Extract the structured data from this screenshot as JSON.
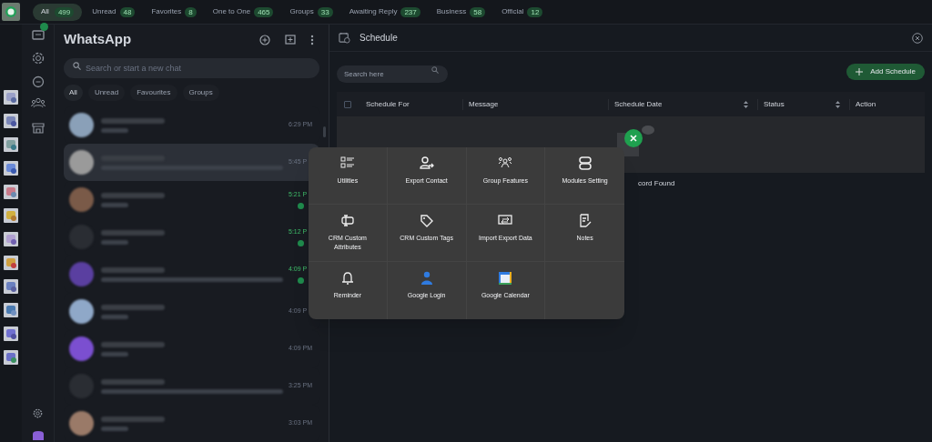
{
  "filters": [
    {
      "label": "All",
      "count": "499",
      "selected": true
    },
    {
      "label": "Unread",
      "count": "48",
      "selected": false
    },
    {
      "label": "Favorites",
      "count": "8",
      "selected": false
    },
    {
      "label": "One to One",
      "count": "465",
      "selected": false
    },
    {
      "label": "Groups",
      "count": "33",
      "selected": false
    },
    {
      "label": "Awaiting Reply",
      "count": "237",
      "selected": false
    },
    {
      "label": "Business",
      "count": "58",
      "selected": false
    },
    {
      "label": "Official",
      "count": "12",
      "selected": false
    }
  ],
  "chat_panel": {
    "title": "WhatsApp",
    "search": {
      "placeholder": "Search or start a new chat"
    },
    "chips": [
      {
        "label": "All",
        "selected": true
      },
      {
        "label": "Unread",
        "selected": false
      },
      {
        "label": "Favourites",
        "selected": false
      },
      {
        "label": "Groups",
        "selected": false
      }
    ],
    "chats": [
      {
        "time": "6:29 PM",
        "unread": false,
        "selected": false,
        "color": "#8aa0b8"
      },
      {
        "time": "5:45 P",
        "unread": false,
        "selected": true,
        "color": "#9a9a9a"
      },
      {
        "time": "5:21 P",
        "unread": true,
        "selected": false,
        "color": "#7a5a48"
      },
      {
        "time": "5:12 P",
        "unread": true,
        "selected": false,
        "color": "#2a2d33"
      },
      {
        "time": "4:09 P",
        "unread": true,
        "selected": false,
        "color": "#5a3fa0"
      },
      {
        "time": "4:09 P",
        "unread": false,
        "selected": false,
        "color": "#8fa8c8"
      },
      {
        "time": "4:09 PM",
        "unread": false,
        "selected": false,
        "color": "#7b4fd0"
      },
      {
        "time": "3:25 PM",
        "unread": false,
        "selected": false,
        "color": "#2a2d33"
      },
      {
        "time": "3:03 PM",
        "unread": false,
        "selected": false,
        "color": "#9a7a68"
      }
    ]
  },
  "schedule": {
    "title": "Schedule",
    "search": {
      "placeholder": "Search here"
    },
    "add_button": "Add Schedule",
    "header_checkbox": {
      "checked": false
    },
    "columns": [
      {
        "label": "Schedule For",
        "sortable": false
      },
      {
        "label": "Message",
        "sortable": false
      },
      {
        "label": "Schedule Date",
        "sortable": true
      },
      {
        "label": "Status",
        "sortable": true
      },
      {
        "label": "Action",
        "sortable": false
      }
    ],
    "empty_text": "cord Found"
  },
  "menu": [
    {
      "label": "Utilities",
      "kind": "list"
    },
    {
      "label": "Export Contact",
      "kind": "contact"
    },
    {
      "label": "Group Features",
      "kind": "group"
    },
    {
      "label": "Modules Setting",
      "kind": "modules"
    },
    {
      "label": "CRM Custom Attributes",
      "kind": "attributes"
    },
    {
      "label": "CRM Custom Tags",
      "kind": "tag"
    },
    {
      "label": "Import Export Data",
      "kind": "transfer"
    },
    {
      "label": "Notes",
      "kind": "notes"
    },
    {
      "label": "Reminder",
      "kind": "bell"
    },
    {
      "label": "Google Login",
      "kind": "person"
    },
    {
      "label": "Google Calendar",
      "kind": "calendar"
    }
  ]
}
